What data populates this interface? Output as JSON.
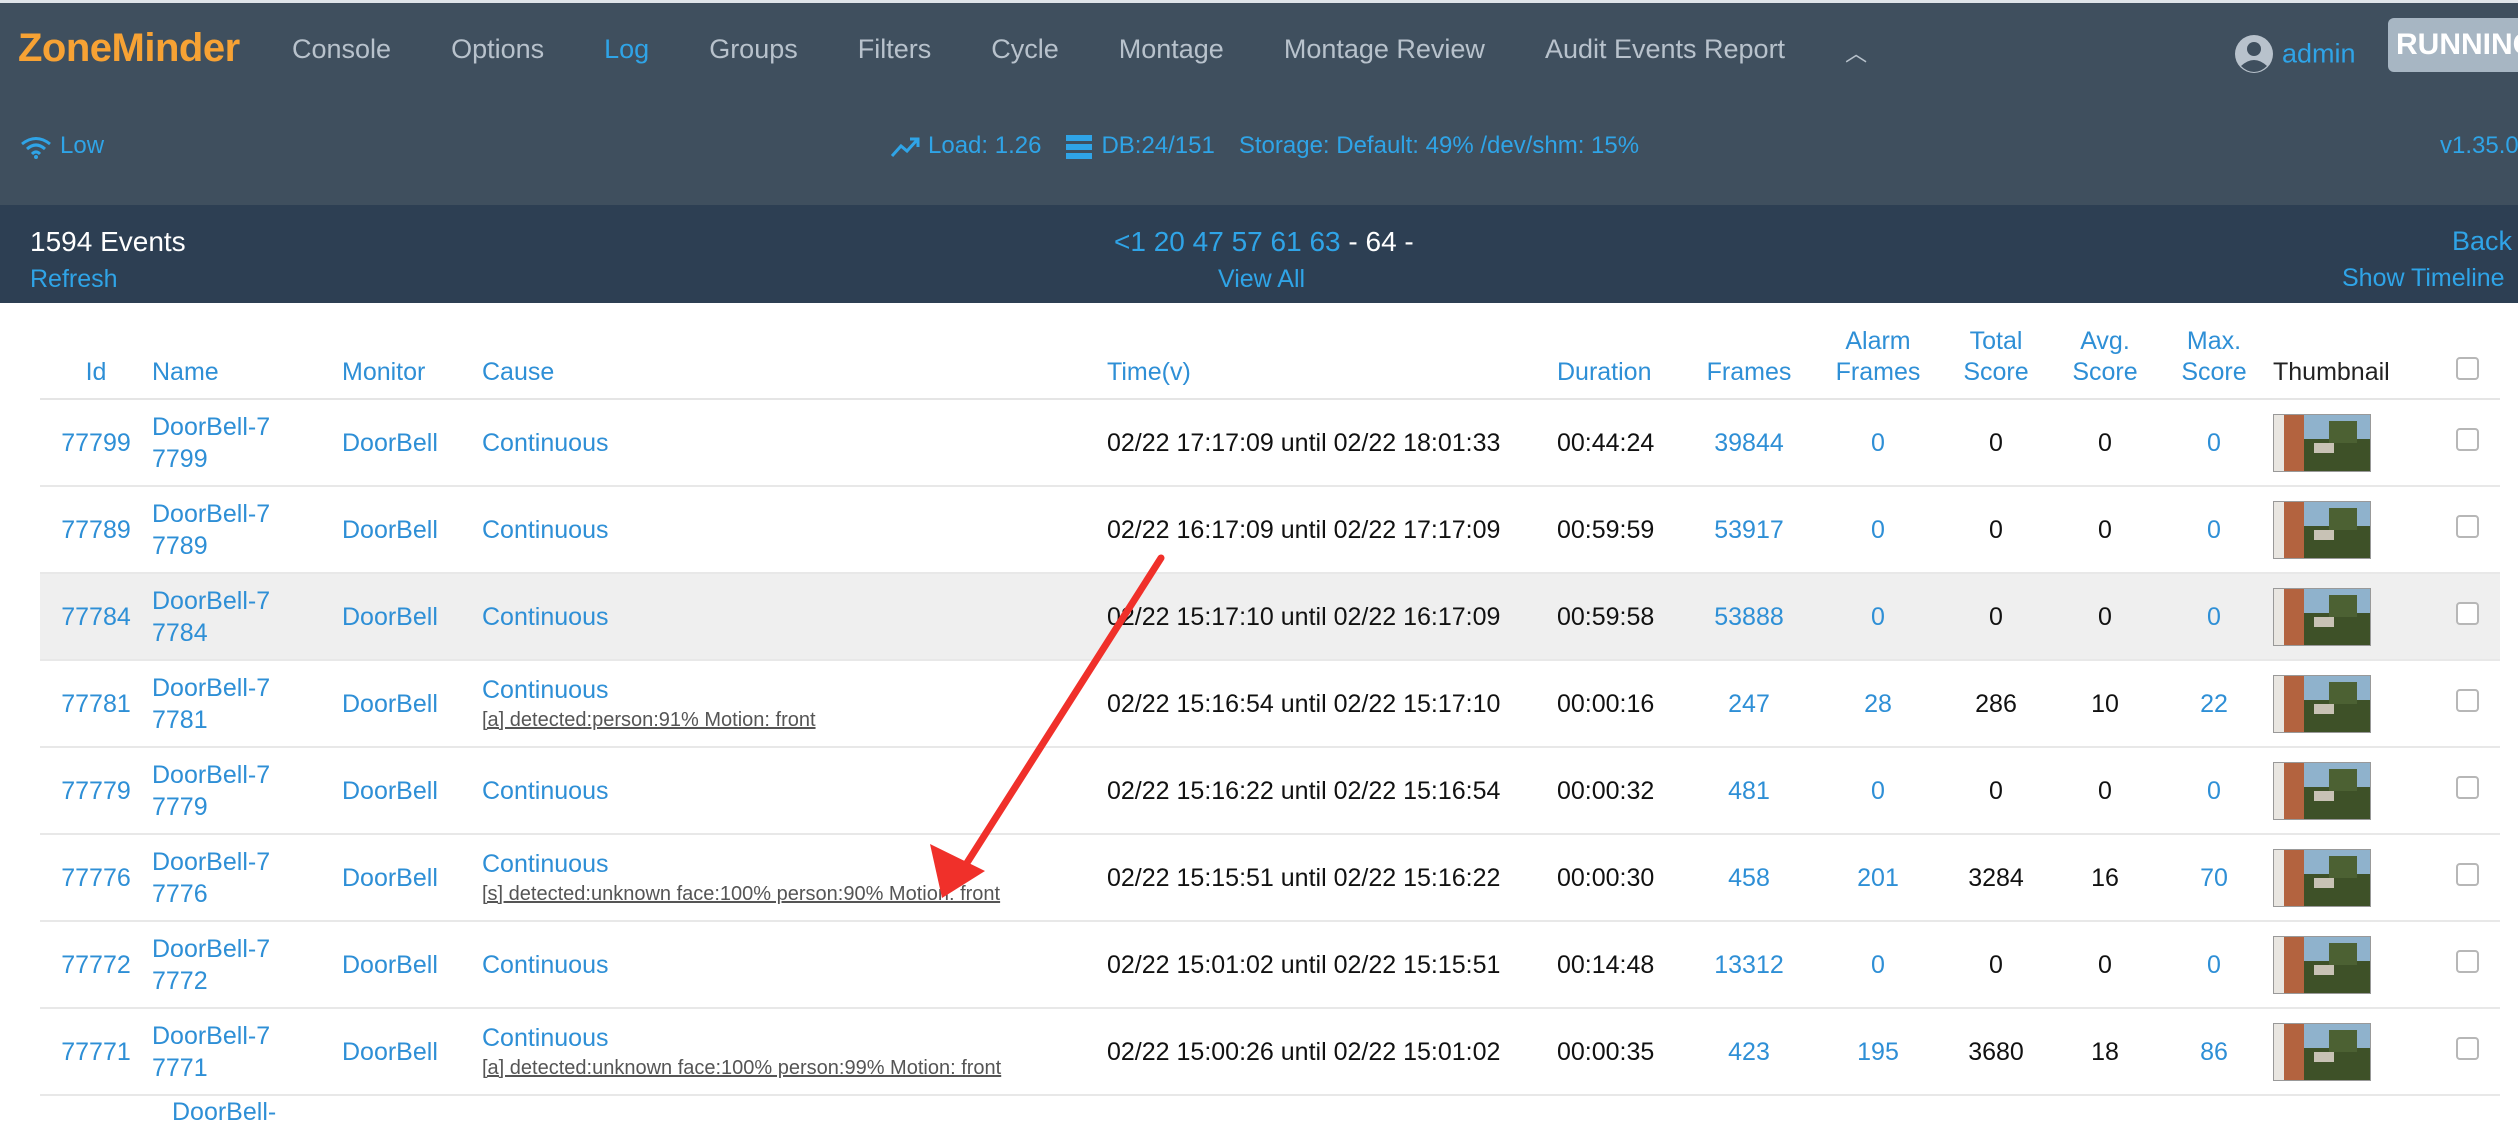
{
  "app": {
    "logo": "ZoneMinder",
    "user": "admin",
    "status": "RUNNING",
    "version": "v1.35.0"
  },
  "nav": {
    "items": [
      "Console",
      "Options",
      "Log",
      "Groups",
      "Filters",
      "Cycle",
      "Montage",
      "Montage Review",
      "Audit Events Report"
    ],
    "active": "Log"
  },
  "status_bar": {
    "bandwidth": "Low",
    "load": "Load: 1.26",
    "db": "DB:24/151",
    "storage": "Storage: Default: 49% /dev/shm: 15%"
  },
  "events_bar": {
    "count": "1594 Events",
    "refresh": "Refresh",
    "pages": [
      "<1",
      "20",
      "47",
      "57",
      "61",
      "63"
    ],
    "current_page": "- 64 -",
    "view_all": "View All",
    "back": "Back",
    "show_timeline": "Show Timeline"
  },
  "table": {
    "headers": {
      "id": "Id",
      "name": "Name",
      "monitor": "Monitor",
      "cause": "Cause",
      "time": "Time(v)",
      "duration": "Duration",
      "frames": "Frames",
      "alarm_frames": "Alarm Frames",
      "total_score": "Total Score",
      "avg_score": "Avg. Score",
      "max_score": "Max. Score",
      "thumbnail": "Thumbnail"
    },
    "rows": [
      {
        "id": "77799",
        "name": "DoorBell-77799",
        "monitor": "DoorBell",
        "cause": "Continuous",
        "notes": "",
        "time": "02/22 17:17:09 until 02/22 18:01:33",
        "duration": "00:44:24",
        "frames": "39844",
        "alarm_frames": "0",
        "total_score": "0",
        "avg_score": "0",
        "max_score": "0"
      },
      {
        "id": "77789",
        "name": "DoorBell-77789",
        "monitor": "DoorBell",
        "cause": "Continuous",
        "notes": "",
        "time": "02/22 16:17:09 until 02/22 17:17:09",
        "duration": "00:59:59",
        "frames": "53917",
        "alarm_frames": "0",
        "total_score": "0",
        "avg_score": "0",
        "max_score": "0"
      },
      {
        "id": "77784",
        "name": "DoorBell-77784",
        "monitor": "DoorBell",
        "cause": "Continuous",
        "notes": "",
        "time": "02/22 15:17:10 until 02/22 16:17:09",
        "duration": "00:59:58",
        "frames": "53888",
        "alarm_frames": "0",
        "total_score": "0",
        "avg_score": "0",
        "max_score": "0"
      },
      {
        "id": "77781",
        "name": "DoorBell-77781",
        "monitor": "DoorBell",
        "cause": "Continuous",
        "notes": "[a] detected:person:91% Motion: front",
        "time": "02/22 15:16:54 until 02/22 15:17:10",
        "duration": "00:00:16",
        "frames": "247",
        "alarm_frames": "28",
        "total_score": "286",
        "avg_score": "10",
        "max_score": "22"
      },
      {
        "id": "77779",
        "name": "DoorBell-77779",
        "monitor": "DoorBell",
        "cause": "Continuous",
        "notes": "",
        "time": "02/22 15:16:22 until 02/22 15:16:54",
        "duration": "00:00:32",
        "frames": "481",
        "alarm_frames": "0",
        "total_score": "0",
        "avg_score": "0",
        "max_score": "0"
      },
      {
        "id": "77776",
        "name": "DoorBell-77776",
        "monitor": "DoorBell",
        "cause": "Continuous",
        "notes": "[s] detected:unknown face:100% person:90% Motion: front",
        "time": "02/22 15:15:51 until 02/22 15:16:22",
        "duration": "00:00:30",
        "frames": "458",
        "alarm_frames": "201",
        "total_score": "3284",
        "avg_score": "16",
        "max_score": "70"
      },
      {
        "id": "77772",
        "name": "DoorBell-77772",
        "monitor": "DoorBell",
        "cause": "Continuous",
        "notes": "",
        "time": "02/22 15:01:02 until 02/22 15:15:51",
        "duration": "00:14:48",
        "frames": "13312",
        "alarm_frames": "0",
        "total_score": "0",
        "avg_score": "0",
        "max_score": "0"
      },
      {
        "id": "77771",
        "name": "DoorBell-77771",
        "monitor": "DoorBell",
        "cause": "Continuous",
        "notes": "[a] detected:unknown face:100% person:99% Motion: front",
        "time": "02/22 15:00:26 until 02/22 15:01:02",
        "duration": "00:00:35",
        "frames": "423",
        "alarm_frames": "195",
        "total_score": "3680",
        "avg_score": "18",
        "max_score": "86"
      }
    ],
    "partial_row_name": "DoorBell-"
  },
  "annotation": {
    "arrow_color": "#f0302a"
  },
  "colors": {
    "accent": "#2fa4e7",
    "logo": "#f7a234",
    "nav_bg": "#3f4f5e",
    "subbar_bg": "#2d3f53"
  }
}
